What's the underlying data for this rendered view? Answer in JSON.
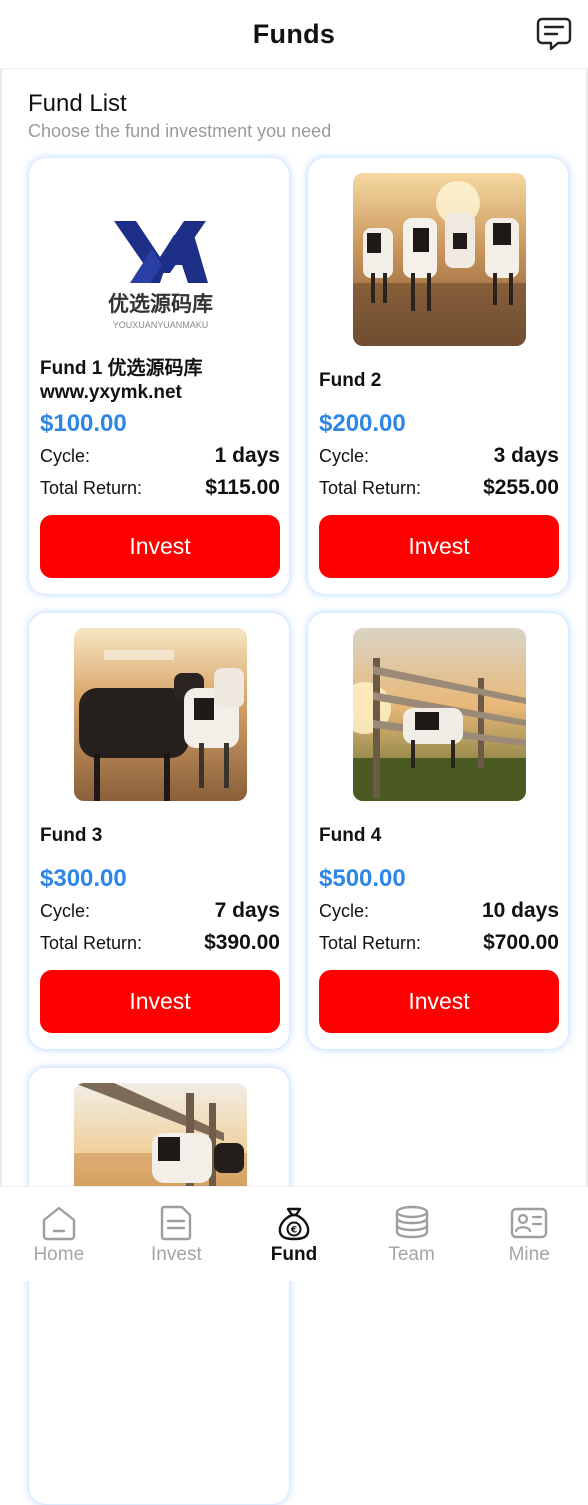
{
  "header": {
    "title": "Funds",
    "message_icon": "message-icon"
  },
  "section": {
    "title": "Fund List",
    "subtitle": "Choose the fund investment you need"
  },
  "labels": {
    "cycle": "Cycle:",
    "total_return": "Total Return:",
    "invest": "Invest"
  },
  "funds": [
    {
      "name": "Fund 1 优选源码库 www.yxymk.net",
      "price": "$100.00",
      "cycle": "1 days",
      "total_return": "$115.00",
      "logo_text": "优选源码库",
      "logo_sub": "YOUXUANYUANMAKU"
    },
    {
      "name": "Fund 2",
      "price": "$200.00",
      "cycle": "3 days",
      "total_return": "$255.00"
    },
    {
      "name": "Fund 3",
      "price": "$300.00",
      "cycle": "7 days",
      "total_return": "$390.00"
    },
    {
      "name": "Fund 4",
      "price": "$500.00",
      "cycle": "10 days",
      "total_return": "$700.00"
    },
    {
      "name": "",
      "price": "",
      "cycle": "",
      "total_return": ""
    }
  ],
  "tabs": [
    {
      "label": "Home",
      "icon": "home-icon",
      "active": false
    },
    {
      "label": "Invest",
      "icon": "document-icon",
      "active": false
    },
    {
      "label": "Fund",
      "icon": "money-bag-icon",
      "active": true
    },
    {
      "label": "Team",
      "icon": "coin-stack-icon",
      "active": false
    },
    {
      "label": "Mine",
      "icon": "id-card-icon",
      "active": false
    }
  ],
  "colors": {
    "accent_blue": "#2e86e6",
    "invest_red": "#ff0000",
    "inactive_tab": "#a5a5a5"
  }
}
